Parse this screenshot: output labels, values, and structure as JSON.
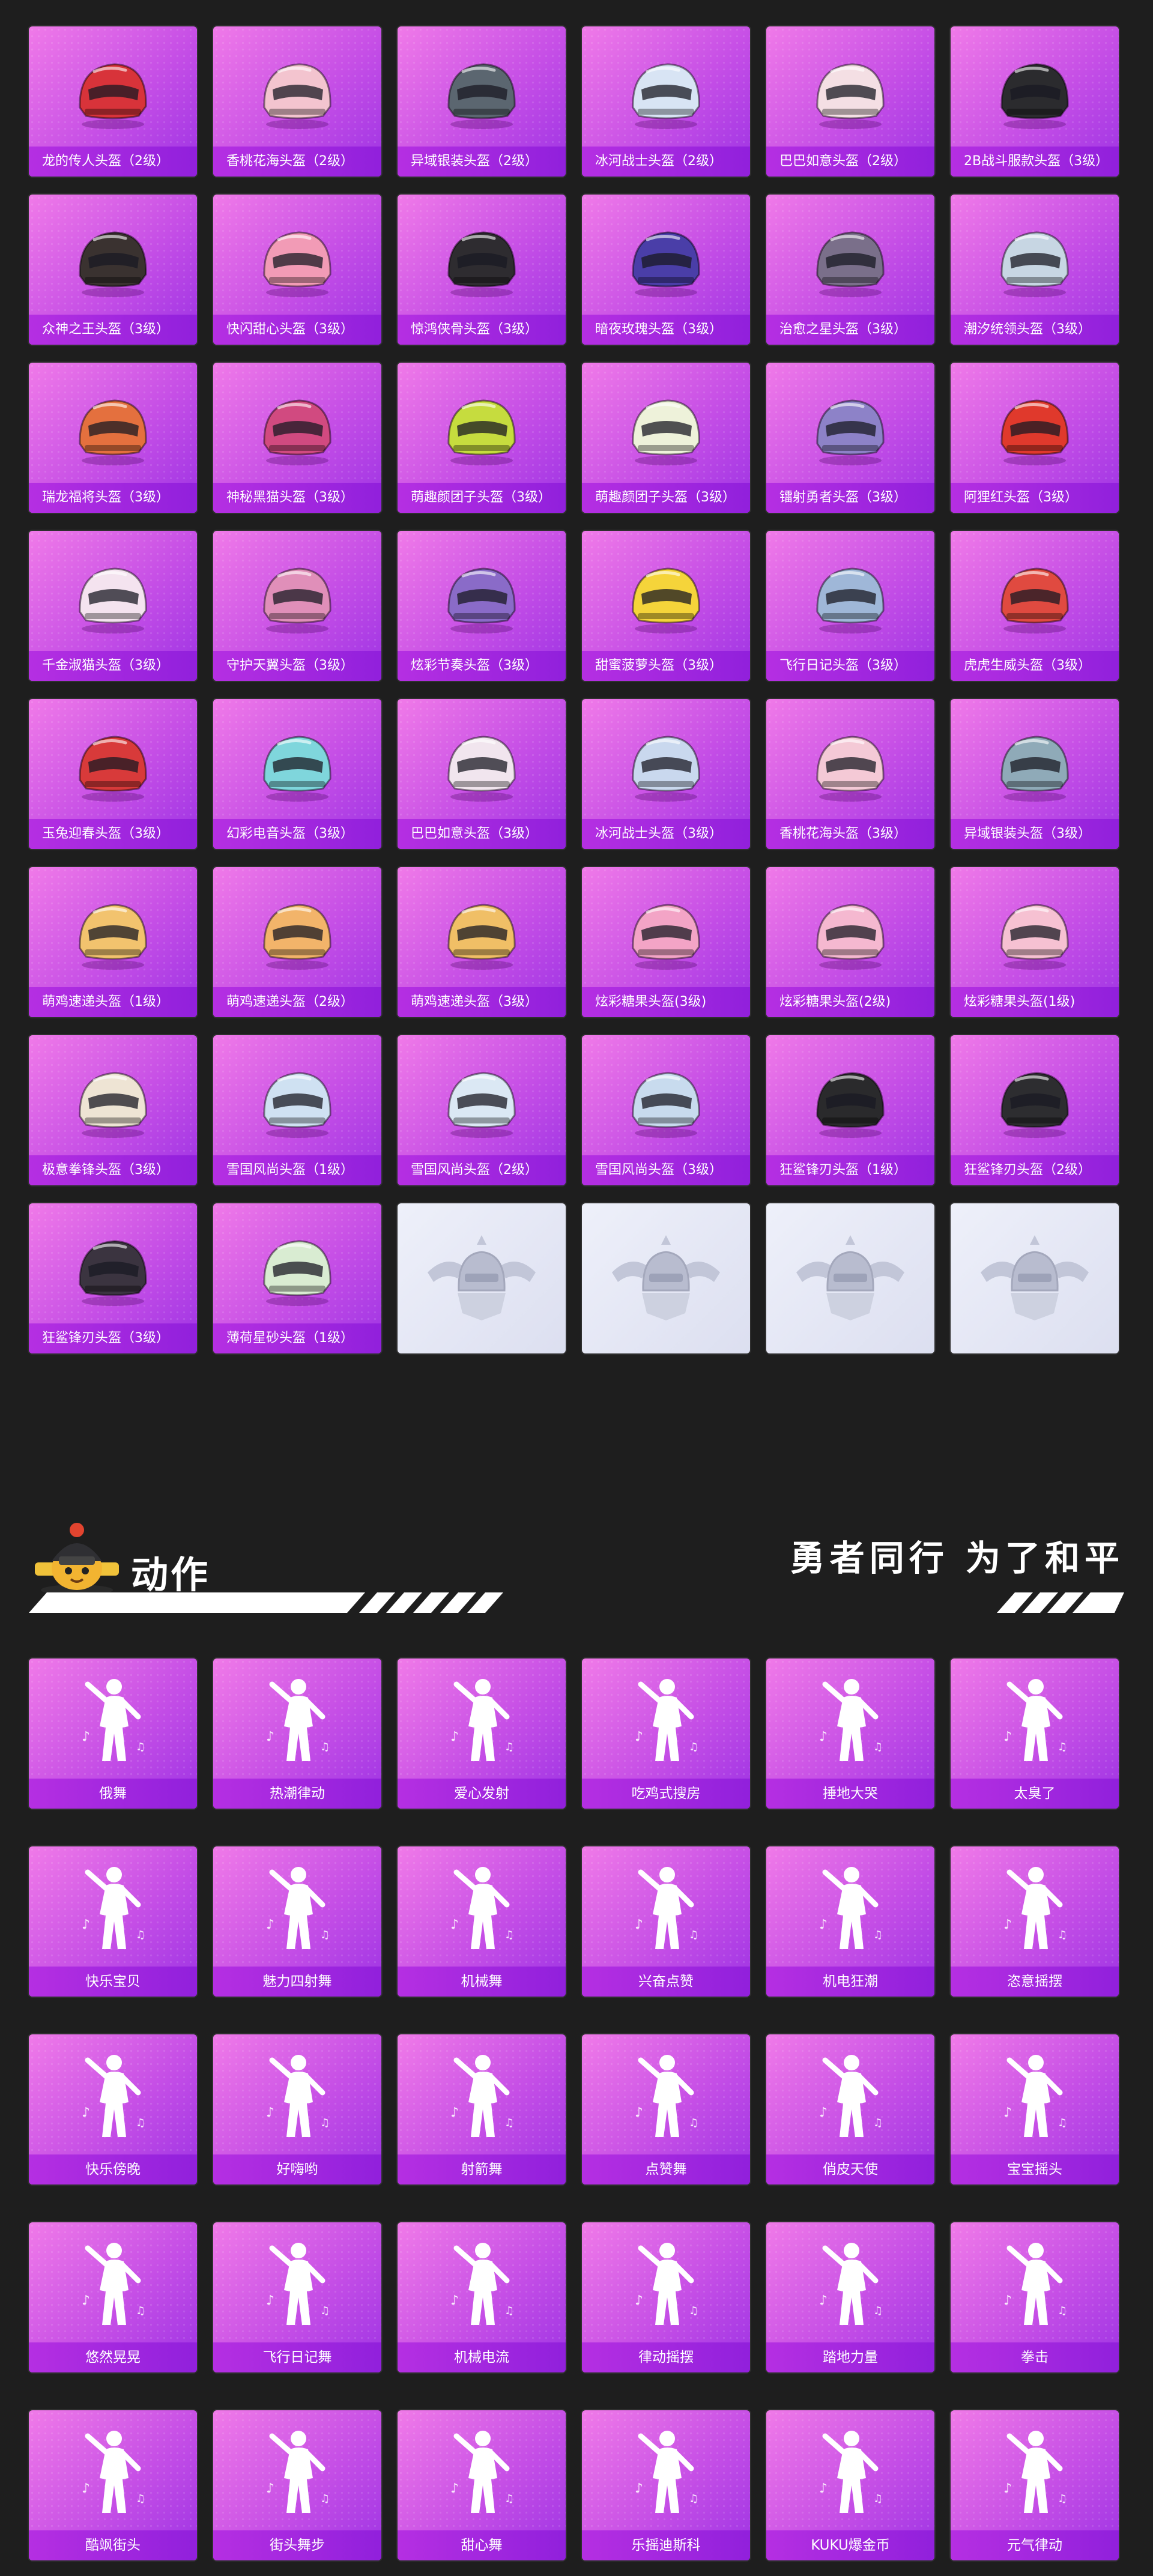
{
  "helmets": [
    "龙的传人头盔（2级）",
    "香桃花海头盔（2级）",
    "异域银装头盔（2级）",
    "冰河战士头盔（2级）",
    "巴巴如意头盔（2级）",
    "2B战斗服款头盔（3级）",
    "众神之王头盔（3级）",
    "快闪甜心头盔（3级）",
    "惊鸿侠骨头盔（3级）",
    "暗夜玫瑰头盔（3级）",
    "治愈之星头盔（3级）",
    "潮汐统领头盔（3级）",
    "瑞龙福将头盔（3级）",
    "神秘黑猫头盔（3级）",
    "萌趣颜团子头盔（3级）",
    "萌趣颜团子头盔（3级）",
    "镭射勇者头盔（3级）",
    "阿狸红头盔（3级）",
    "千金淑猫头盔（3级）",
    "守护天翼头盔（3级）",
    "炫彩节奏头盔（3级）",
    "甜蜜菠萝头盔（3级）",
    "飞行日记头盔（3级）",
    "虎虎生威头盔（3级）",
    "玉兔迎春头盔（3级）",
    "幻彩电音头盔（3级）",
    "巴巴如意头盔（3级）",
    "冰河战士头盔（3级）",
    "香桃花海头盔（3级）",
    "异域银装头盔（3级）",
    "萌鸡速递头盔（1级）",
    "萌鸡速递头盔（2级）",
    "萌鸡速递头盔（3级）",
    "炫彩糖果头盔(3级)",
    "炫彩糖果头盔(2级)",
    "炫彩糖果头盔(1级)",
    "极意拳锋头盔（3级）",
    "雪国风尚头盔（1级）",
    "雪国风尚头盔（2级）",
    "雪国风尚头盔（3级）",
    "狂鲨锋刃头盔（1级）",
    "狂鲨锋刃头盔（2级）",
    "狂鲨锋刃头盔（3级）",
    "薄荷星砂头盔（1级）"
  ],
  "helmet_colors": [
    "#d8333a",
    "#f3c4cf",
    "#5b6670",
    "#d8e4f4",
    "#f4dfe4",
    "#2b2b2e",
    "#3a3230",
    "#f29bb6",
    "#2e2c30",
    "#4a3ea8",
    "#7a6f8a",
    "#c7d6e3",
    "#e4703e",
    "#d14a80",
    "#c6dc3e",
    "#eef2da",
    "#8d82c8",
    "#e0392c",
    "#f4e3ef",
    "#e08fb9",
    "#8a6bc8",
    "#f5d43a",
    "#9fb7d8",
    "#e04a40",
    "#d83a3a",
    "#7fd6dc",
    "#f1e5ee",
    "#c9d8ee",
    "#f4c9d6",
    "#8faab8",
    "#f2c36e",
    "#f2b46a",
    "#f0bf66",
    "#f3a4c6",
    "#f5b8d0",
    "#f6c1d2",
    "#eee4d4",
    "#cfe1f2",
    "#dbe8f4",
    "#c8dbee",
    "#2a2a2c",
    "#2d2d30",
    "#3b3440",
    "#d9ecd2"
  ],
  "placeholder_count": 4,
  "section": {
    "title": "动作",
    "slogan": "勇者同行 为了和平"
  },
  "emotes": [
    "俄舞",
    "热潮律动",
    "爱心发射",
    "吃鸡式搜房",
    "捶地大哭",
    "太臭了",
    "快乐宝贝",
    "魅力四射舞",
    "机械舞",
    "兴奋点赞",
    "机电狂潮",
    "恣意摇摆",
    "快乐傍晚",
    "好嗨哟",
    "射箭舞",
    "点赞舞",
    "俏皮天使",
    "宝宝摇头",
    "悠然晃晃",
    "飞行日记舞",
    "机械电流",
    "律动摇摆",
    "踏地力量",
    "拳击",
    "酷飒街头",
    "街头舞步",
    "甜心舞",
    "乐摇迪斯科",
    "KUKU爆金币",
    "元气律动"
  ]
}
